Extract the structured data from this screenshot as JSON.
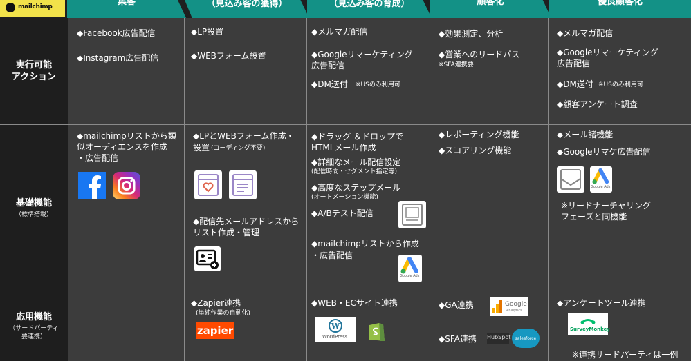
{
  "header": {
    "logo_text": "mailchimp",
    "columns": [
      {
        "label": "集客"
      },
      {
        "label": "（見込み客の獲得）"
      },
      {
        "label": "（見込み客の育成）"
      },
      {
        "label": "顧客化"
      },
      {
        "label": "優良顧客化"
      }
    ]
  },
  "rows": {
    "actions": {
      "label": "実行可能",
      "label2": "アクション",
      "c1": [
        "◆Facebook広告配信",
        "◆Instagram広告配信"
      ],
      "c2": [
        "◆LP設置",
        "◆WEBフォーム設置"
      ],
      "c3": [
        "◆メルマガ配信",
        "◆Googleリマーケティング",
        "広告配信",
        "◆DM送付",
        "※USのみ利用可"
      ],
      "c4": [
        "◆効果測定、分析",
        "◆営業へのリードパス",
        "※SFA連携要"
      ],
      "c5": [
        "◆メルマガ配信",
        "◆Googleリマーケティング",
        "広告配信",
        "◆DM送付",
        "※USのみ利用可",
        "◆顧客アンケート調査"
      ]
    },
    "basic": {
      "label": "基礎機能",
      "sub": "（標準搭載）",
      "c1": [
        "◆mailchimpリストから類",
        "似オーディエンスを作成",
        "・広告配信"
      ],
      "c2": [
        "◆LPとWEBフォーム作成・",
        "設置",
        "(コーディング不要)",
        "◆配信先メールアドレスから",
        "リスト作成・管理"
      ],
      "c3": [
        "◆ドラッグ ＆ドロップで",
        "HTMLメール作成",
        "◆詳細なメール配信設定",
        "(配信時間・セグメント指定等)",
        "◆高度なステップメール",
        "(オートメーション機能)",
        "◆A/Bテスト配信",
        "◆mailchimpリストから作成",
        "・広告配信"
      ],
      "c4": [
        "◆レポーティング機能",
        "◆スコアリング機能"
      ],
      "c5": [
        "◆メール諸機能",
        "◆Googleリマケ広告配信",
        "※リードナーチャリング",
        "フェーズと同機能"
      ],
      "google_ads_label": "Google Ads"
    },
    "advanced": {
      "label": "応用機能",
      "sub1": "（サードパーティ",
      "sub2": "要連携）",
      "c2": [
        "◆Zapier連携",
        "(単純作業の自動化)"
      ],
      "c3": [
        "◆WEB・ECサイト連携"
      ],
      "c4": [
        "◆GA連携",
        "◆SFA連携"
      ],
      "c5": [
        "◆アンケートツール連携",
        "※連携サードパーティは一例"
      ],
      "zapier": "zapier",
      "wordpress": "WordPress",
      "google_analytics": "Google",
      "google_analytics_sub": "Analytics",
      "hubspot": "HubSpot",
      "salesforce": "salesforce",
      "surveymonkey": "SurveyMonkey"
    }
  },
  "colors": {
    "header_teal": "#139186",
    "logo_yellow": "#f2e24a",
    "zapier_orange": "#ff4a00",
    "salesforce_blue": "#1798c1"
  }
}
